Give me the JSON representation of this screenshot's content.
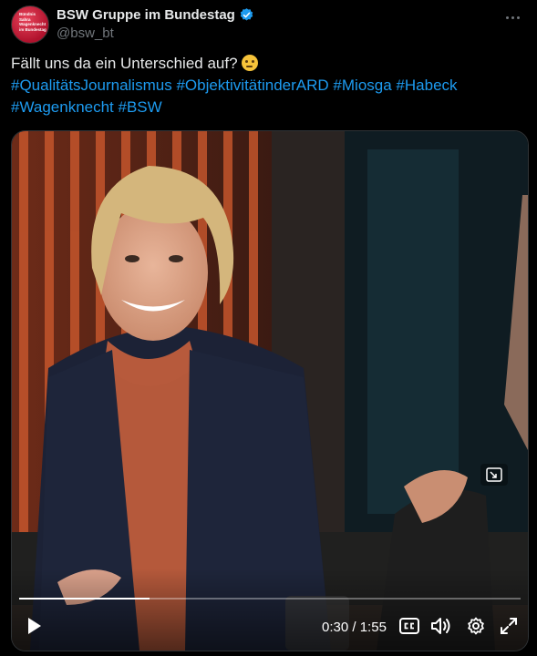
{
  "author": {
    "display_name": "BSW Gruppe im Bundestag",
    "handle": "@bsw_bt",
    "avatar_text": "Bündnis\nSahra\nWagenknecht\nim Bundestag",
    "verified": true
  },
  "tweet": {
    "text_main": "Fällt uns da ein Unterschied auf?",
    "emoji": "thinking-face",
    "hashtags": [
      "#QualitätsJournalismus",
      "#ObjektivitätinderARD",
      "#Miosga",
      "#Habeck",
      "#Wagenknecht",
      "#BSW"
    ]
  },
  "video": {
    "current_time": "0:30",
    "duration": "1:55",
    "progress_fraction": 0.26,
    "icons": [
      "play-icon",
      "closed-captions-icon",
      "volume-icon",
      "settings-icon",
      "fullscreen-icon",
      "picture-in-picture-icon",
      "more-options-icon"
    ]
  },
  "colors": {
    "accent": "#1d9bf0",
    "text": "#e7e9ea",
    "muted": "#71767b",
    "background": "#000000"
  }
}
